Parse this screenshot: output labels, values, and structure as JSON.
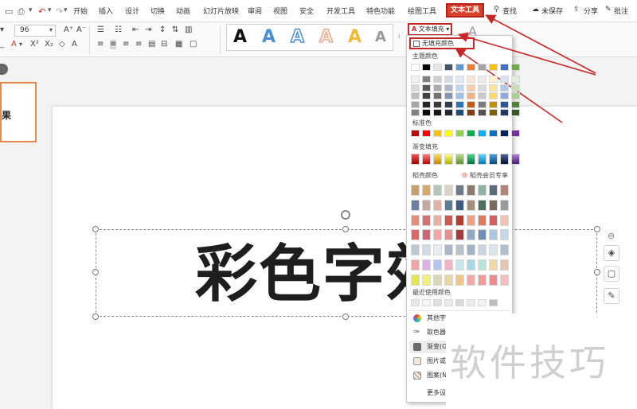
{
  "menubar": {
    "tabs": [
      "开始",
      "插入",
      "设计",
      "切换",
      "动画",
      "幻灯片放映",
      "审阅",
      "视图",
      "安全",
      "开发工具",
      "特色功能",
      "绘图工具"
    ],
    "active_tab": "文本工具",
    "search": "查找",
    "unsaved": "未保存",
    "share": "分享",
    "comment": "批注"
  },
  "ribbon": {
    "font_size": "96",
    "text_fill_label": "文本填充",
    "wordart_letter": "A"
  },
  "thumbnail": {
    "text": "果"
  },
  "slide": {
    "big_text": "彩色字效"
  },
  "dropdown": {
    "no_fill": "无填充颜色",
    "theme_colors": "主题颜色",
    "standard_colors": "标准色",
    "gradient_fill": "渐变填充",
    "rice_colors": "稻壳颜色",
    "rice_vip": "稻壳会员专享",
    "recent_colors": "最近使用颜色",
    "items": [
      "其他字",
      "取色器",
      "渐变(G",
      "图片或",
      "图案(N",
      "更多设"
    ]
  },
  "watermark": "软件技巧",
  "colors": {
    "accent_red": "#d8422a",
    "arrow_red": "#c62828"
  }
}
